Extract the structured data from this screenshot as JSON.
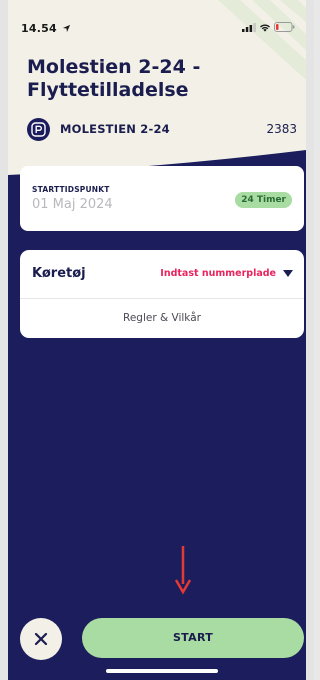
{
  "status_bar": {
    "time": "14.54"
  },
  "header": {
    "title": "Molestien 2-24 - Flyttetilladelse",
    "location_name": "MOLESTIEN 2-24",
    "location_code": "2383"
  },
  "start_card": {
    "label": "STARTTIDSPUNKT",
    "date": "01 Maj 2024",
    "duration": "24 Timer"
  },
  "vehicle_card": {
    "label": "Køretøj",
    "plate_prompt": "Indtast nummerplade",
    "rules_link": "Regler & Vilkår"
  },
  "footer": {
    "start_label": "START"
  },
  "colors": {
    "navy": "#1b1d5c",
    "cream": "#f3f1e7",
    "green": "#a9dca2",
    "pink_red": "#e8245f",
    "arrow_red": "#e53935"
  },
  "icons": {
    "location": "parking-garage-icon",
    "close": "close-icon",
    "dropdown": "chevron-down-icon",
    "hint": "red-arrow-down-icon"
  }
}
